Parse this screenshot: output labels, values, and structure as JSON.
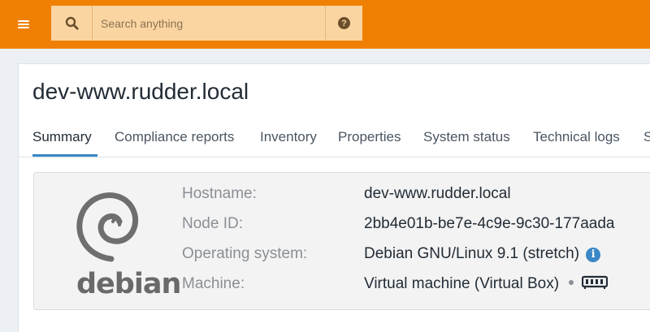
{
  "topbar": {
    "menu_icon": "hamburger-menu-icon",
    "search": {
      "placeholder": "Search anything",
      "icon": "search-icon"
    },
    "help": {
      "icon": "question-circle-icon",
      "glyph": "?"
    },
    "color": "#f08004"
  },
  "node": {
    "title": "dev-www.rudder.local",
    "tabs": [
      {
        "label": "Summary",
        "active": true
      },
      {
        "label": "Compliance reports"
      },
      {
        "label": "Inventory"
      },
      {
        "label": "Properties"
      },
      {
        "label": "System status"
      },
      {
        "label": "Technical logs"
      },
      {
        "label": "S"
      }
    ],
    "os_logo": {
      "text": "debian",
      "icon": "debian-swirl-icon"
    },
    "details": [
      {
        "label": "Hostname:",
        "value": "dev-www.rudder.local"
      },
      {
        "label": "Node ID:",
        "value": "2bb4e01b-be7e-4c9e-9c30-177aada"
      },
      {
        "label": "Operating system:",
        "value": "Debian GNU/Linux 9.1 (stretch)",
        "icon": "info-circle-icon"
      },
      {
        "label": "Machine:",
        "value": "Virtual machine (Virtual Box)",
        "icon": "memory-chip-icon"
      }
    ]
  },
  "colors": {
    "accent": "#3a87c6",
    "topbar": "#f08004",
    "search_bg": "#fbd5a1"
  }
}
